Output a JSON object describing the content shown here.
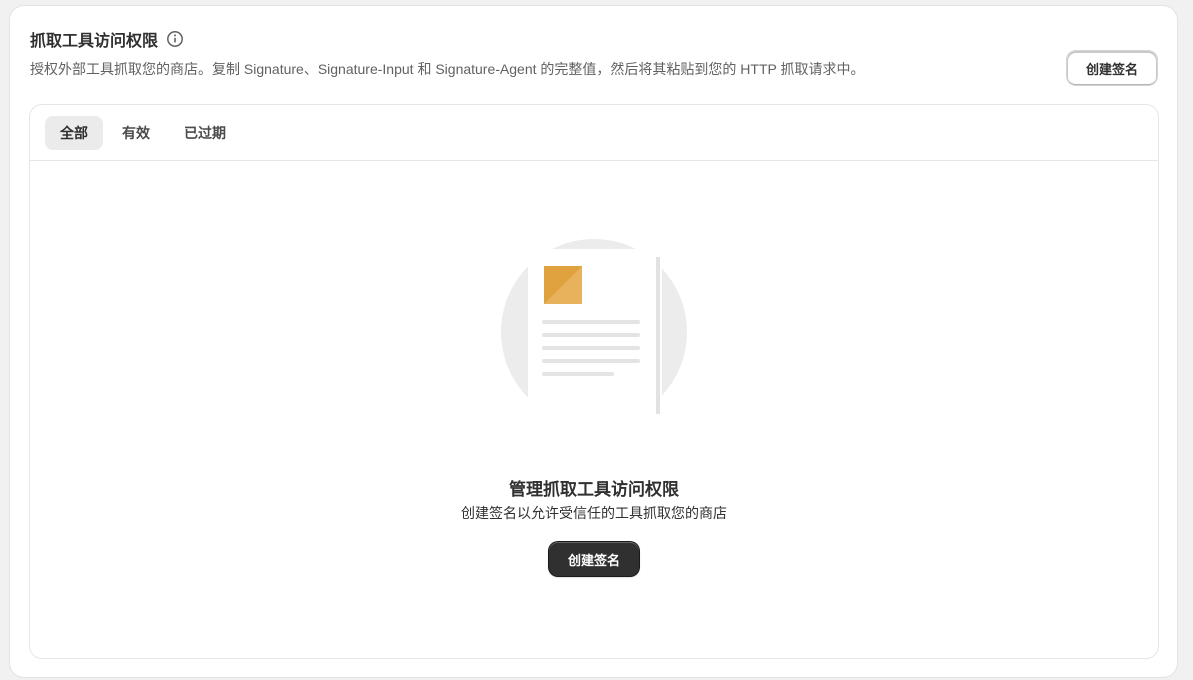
{
  "section": {
    "title": "抓取工具访问权限",
    "description": "授权外部工具抓取您的商店。复制 Signature、Signature-Input 和 Signature-Agent 的完整值，然后将其粘贴到您的 HTTP 抓取请求中。",
    "create_button": "创建签名"
  },
  "tabs": [
    {
      "label": "全部",
      "active": true
    },
    {
      "label": "有效",
      "active": false
    },
    {
      "label": "已过期",
      "active": false
    }
  ],
  "empty_state": {
    "title": "管理抓取工具访问权限",
    "subtitle": "创建签名以允许受信任的工具抓取您的商店",
    "button": "创建签名"
  },
  "colors": {
    "primary_button": "#303030",
    "illustration_accent": "#e0a13f"
  }
}
